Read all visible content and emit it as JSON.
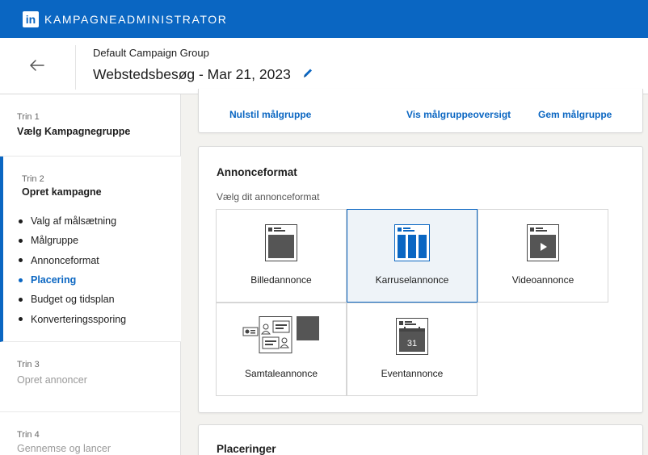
{
  "app": {
    "logo": "in",
    "title": "KAMPAGNEADMINISTRATOR"
  },
  "header": {
    "back_icon": "arrow-left-icon",
    "group": "Default Campaign Group",
    "campaign": "Webstedsbesøg - Mar 21, 2023",
    "edit_icon": "pencil-icon"
  },
  "sidebar": {
    "steps": [
      {
        "num": "Trin 1",
        "name": "Vælg Kampagnegruppe"
      },
      {
        "num": "Trin 2",
        "name": "Opret kampagne",
        "items": [
          "Valg af målsætning",
          "Målgruppe",
          "Annonceformat",
          "Placering",
          "Budget og tidsplan",
          "Konverteringssporing"
        ],
        "current": "Placering"
      },
      {
        "num": "Trin 3",
        "name": "Opret annoncer"
      },
      {
        "num": "Trin 4",
        "name": "Gennemse og lancer"
      }
    ]
  },
  "audience_bar": {
    "reset": "Nulstil målgruppe",
    "overview": "Vis målgruppeoversigt",
    "save": "Gem målgruppe"
  },
  "ad_format": {
    "title": "Annonceformat",
    "hint": "Vælg dit annonceformat",
    "options": [
      {
        "label": "Billedannonce",
        "icon": "image-ad-icon"
      },
      {
        "label": "Karruselannonce",
        "icon": "carousel-ad-icon",
        "selected": true
      },
      {
        "label": "Videoannonce",
        "icon": "video-ad-icon"
      },
      {
        "label": "Samtaleannonce",
        "icon": "conversation-ad-icon"
      },
      {
        "label": "Eventannonce",
        "icon": "event-ad-icon",
        "day": "31"
      }
    ],
    "accent": "#0a66c2"
  },
  "placements": {
    "title": "Placeringer"
  }
}
